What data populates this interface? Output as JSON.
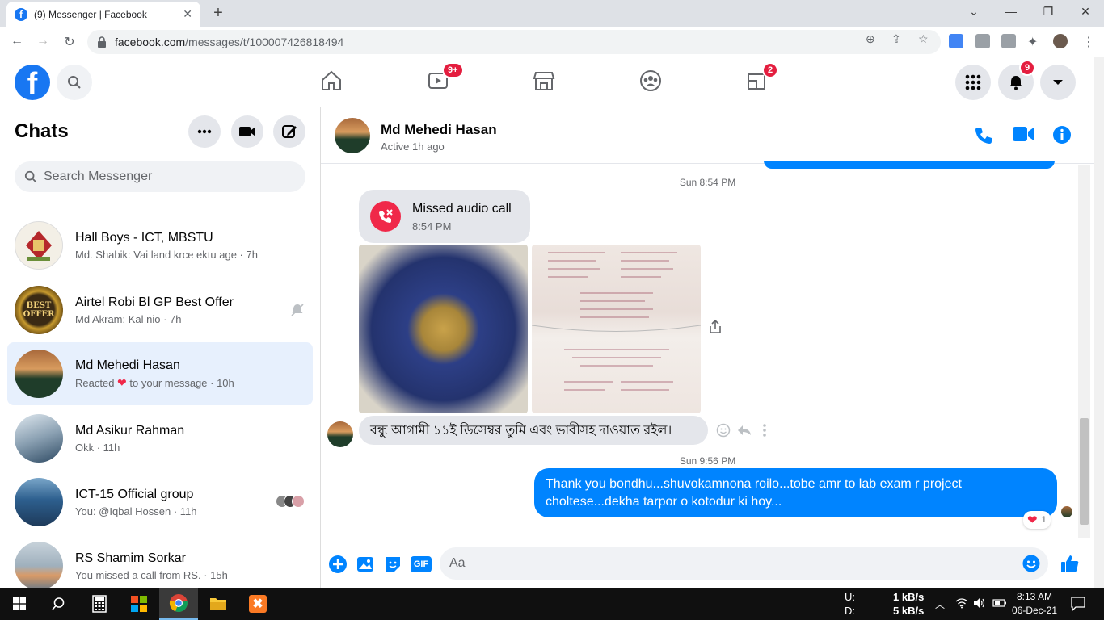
{
  "browser": {
    "tab_title": "(9) Messenger | Facebook",
    "url_domain": "facebook.com",
    "url_path": "/messages/t/100007426818494"
  },
  "fb_header": {
    "watch_badge": "9+",
    "gaming_badge": "2",
    "notifications_badge": "9"
  },
  "sidebar": {
    "title": "Chats",
    "search_placeholder": "Search Messenger",
    "chats": [
      {
        "name": "Hall Boys - ICT, MBSTU",
        "preview": "Md. Shabik: Vai land krce ektu age · 7h"
      },
      {
        "name": "Airtel Robi Bl GP Best Offer",
        "preview": "Md Akram: Kal nio · 7h"
      },
      {
        "name": "Md Mehedi Hasan",
        "preview_pre": "Reacted",
        "preview_post": "to your message · 10h"
      },
      {
        "name": "Md Asikur Rahman",
        "preview": "Okk · 11h"
      },
      {
        "name": "ICT-15 Official group",
        "preview": "You: @Iqbal Hossen · 11h"
      },
      {
        "name": "RS Shamim Sorkar",
        "preview": "You missed a call from RS. · 15h"
      }
    ],
    "avatar_text": {
      "best_offer": "BEST OFFER"
    }
  },
  "conversation": {
    "name": "Md Mehedi Hasan",
    "status": "Active 1h ago",
    "timestamp1": "Sun 8:54 PM",
    "missed_call_title": "Missed audio call",
    "missed_call_time": "8:54 PM",
    "bengali_message": "বন্ধু আগামী ১১ই ডিসেম্বর তুমি এবং ভাবীসহ  দাওয়াত রইল।",
    "timestamp2": "Sun 9:56 PM",
    "my_message": "Thank you bondhu...shuvokamnona roilo...tobe amr to lab exam r project choltese...dekha tarpor o kotodur ki hoy...",
    "reaction_count": "1",
    "composer_placeholder": "Aa"
  },
  "taskbar": {
    "upload_label": "U:",
    "download_label": "D:",
    "upload_speed": "1 kB/s",
    "download_speed": "5 kB/s",
    "time": "8:13 AM",
    "date": "06-Dec-21"
  },
  "colors": {
    "fb_blue": "#1877f2",
    "messenger_blue": "#0084ff",
    "badge_red": "#e41e3f",
    "active_chat_bg": "#e7f0fd"
  }
}
